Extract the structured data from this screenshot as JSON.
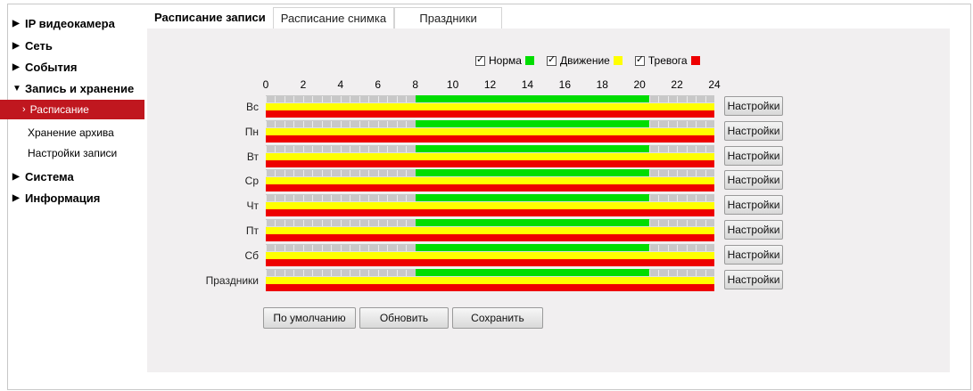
{
  "sidebar": {
    "items": [
      {
        "label": "IP видеокамера"
      },
      {
        "label": "Сеть"
      },
      {
        "label": "События"
      },
      {
        "label": "Запись и хранение"
      },
      {
        "label": "Система"
      },
      {
        "label": "Информация"
      }
    ],
    "sub_items": [
      {
        "label": "Расписание",
        "active": true
      },
      {
        "label": "Хранение архива"
      },
      {
        "label": "Настройки записи"
      }
    ]
  },
  "tabs": [
    {
      "label": "Расписание записи",
      "active": true
    },
    {
      "label": "Расписание снимка"
    },
    {
      "label": "Праздники"
    }
  ],
  "legend": [
    {
      "label": "Норма",
      "checked": true,
      "color": "#00dd00"
    },
    {
      "label": "Движение",
      "checked": true,
      "color": "#ffff00"
    },
    {
      "label": "Тревога",
      "checked": true,
      "color": "#ee0000"
    }
  ],
  "axis": {
    "hour_labels": [
      "0",
      "2",
      "4",
      "6",
      "8",
      "10",
      "12",
      "14",
      "16",
      "18",
      "20",
      "22",
      "24"
    ]
  },
  "schedule": {
    "normal_color": "#00dd00",
    "motion_color": "#ffff00",
    "alarm_color": "#ee0000",
    "empty_color": "#c8c8c8",
    "days": [
      {
        "label": "Вс",
        "normal_from": 8,
        "normal_to": 20.5
      },
      {
        "label": "Пн",
        "normal_from": 8,
        "normal_to": 20.5
      },
      {
        "label": "Вт",
        "normal_from": 8,
        "normal_to": 20.5
      },
      {
        "label": "Ср",
        "normal_from": 8,
        "normal_to": 20.5
      },
      {
        "label": "Чт",
        "normal_from": 8,
        "normal_to": 20.5
      },
      {
        "label": "Пт",
        "normal_from": 8,
        "normal_to": 20.5
      },
      {
        "label": "Сб",
        "normal_from": 8,
        "normal_to": 20.5
      },
      {
        "label": "Праздники",
        "normal_from": 8,
        "normal_to": 20.5
      }
    ],
    "settings_label": "Настройки"
  },
  "actions": {
    "default_label": "По умолчанию",
    "refresh_label": "Обновить",
    "save_label": "Сохранить"
  }
}
